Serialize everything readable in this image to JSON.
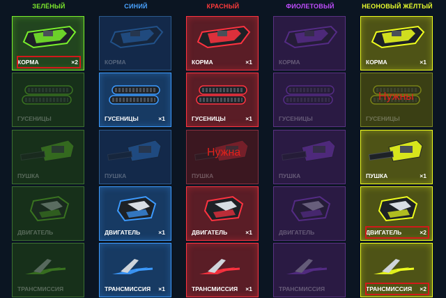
{
  "columns": [
    {
      "title": "ЗЕЛЁНЫЙ",
      "title_color": "#7eea2d",
      "bg": "#22451f",
      "bg_dim": "#17301a",
      "border": "#3c7030",
      "accent": "#7af02c",
      "items": [
        {
          "label": "КОРМА",
          "count": "×2",
          "active": true,
          "highlight": true,
          "icon": "hull-icon"
        },
        {
          "label": "ГУСЕНИЦЫ",
          "count": "",
          "active": false,
          "highlight": false,
          "icon": "tracks-icon"
        },
        {
          "label": "ПУШКА",
          "count": "",
          "active": false,
          "highlight": false,
          "icon": "turret-icon"
        },
        {
          "label": "ДВИГАТЕЛЬ",
          "count": "",
          "active": false,
          "highlight": false,
          "icon": "engine-icon"
        },
        {
          "label": "ТРАНСМИССИЯ",
          "count": "",
          "active": false,
          "highlight": false,
          "icon": "transmission-icon"
        }
      ]
    },
    {
      "title": "СИНИЙ",
      "title_color": "#4aa3ff",
      "bg": "#173a63",
      "bg_dim": "#13294a",
      "border": "#2c5b8e",
      "accent": "#3d9bff",
      "items": [
        {
          "label": "КОРМА",
          "count": "",
          "active": false,
          "highlight": false,
          "icon": "hull-icon"
        },
        {
          "label": "ГУСЕНИЦЫ",
          "count": "×1",
          "active": true,
          "highlight": false,
          "icon": "tracks-icon"
        },
        {
          "label": "ПУШКА",
          "count": "",
          "active": false,
          "highlight": false,
          "icon": "turret-icon"
        },
        {
          "label": "ДВИГАТЕЛЬ",
          "count": "×1",
          "active": true,
          "highlight": false,
          "icon": "engine-icon"
        },
        {
          "label": "ТРАНСМИССИЯ",
          "count": "×1",
          "active": true,
          "highlight": false,
          "icon": "transmission-icon"
        }
      ]
    },
    {
      "title": "КРАСНЫЙ",
      "title_color": "#ff3b3b",
      "bg": "#5a1d26",
      "bg_dim": "#3b1720",
      "border": "#8a3040",
      "accent": "#ff3340",
      "items": [
        {
          "label": "КОРМА",
          "count": "×1",
          "active": true,
          "highlight": false,
          "icon": "hull-icon"
        },
        {
          "label": "ГУСЕНИЦЫ",
          "count": "×1",
          "active": true,
          "highlight": false,
          "icon": "tracks-icon"
        },
        {
          "label": "ПУШКА",
          "count": "",
          "active": false,
          "highlight": false,
          "icon": "turret-icon"
        },
        {
          "label": "ДВИГАТЕЛЬ",
          "count": "×1",
          "active": true,
          "highlight": false,
          "icon": "engine-icon"
        },
        {
          "label": "ТРАНСМИССИЯ",
          "count": "×1",
          "active": true,
          "highlight": false,
          "icon": "transmission-icon"
        }
      ]
    },
    {
      "title": "ФИОЛЕТОВЫЙ",
      "title_color": "#c04dff",
      "bg": "#3a1d57",
      "bg_dim": "#2a1a43",
      "border": "#5a3283",
      "accent": "#a44dff",
      "items": [
        {
          "label": "КОРМА",
          "count": "",
          "active": false,
          "highlight": false,
          "icon": "hull-icon"
        },
        {
          "label": "ГУСЕНИЦЫ",
          "count": "",
          "active": false,
          "highlight": false,
          "icon": "tracks-icon"
        },
        {
          "label": "ПУШКА",
          "count": "",
          "active": false,
          "highlight": false,
          "icon": "turret-icon"
        },
        {
          "label": "ДВИГАТЕЛЬ",
          "count": "",
          "active": false,
          "highlight": false,
          "icon": "engine-icon"
        },
        {
          "label": "ТРАНСМИССИЯ",
          "count": "",
          "active": false,
          "highlight": false,
          "icon": "transmission-icon"
        }
      ]
    },
    {
      "title": "НЕОНОВЫЙ ЖЁЛТЫЙ",
      "title_color": "#eaff2d",
      "bg": "#4e5316",
      "bg_dim": "#3a3f14",
      "border": "#7e8a22",
      "accent": "#f0ff1e",
      "items": [
        {
          "label": "КОРМА",
          "count": "×1",
          "active": true,
          "highlight": false,
          "icon": "hull-icon"
        },
        {
          "label": "ГУСЕНИЦЫ",
          "count": "",
          "active": false,
          "highlight": false,
          "icon": "tracks-icon"
        },
        {
          "label": "ПУШКА",
          "count": "×1",
          "active": true,
          "highlight": false,
          "icon": "turret-icon"
        },
        {
          "label": "ДВИГАТЕЛЬ",
          "count": "×2",
          "active": true,
          "highlight": true,
          "icon": "engine-icon"
        },
        {
          "label": "ТРАНСМИССИЯ",
          "count": "×2",
          "active": true,
          "highlight": true,
          "icon": "transmission-icon"
        }
      ]
    }
  ],
  "annotations": {
    "red_needed": "Нужна",
    "yellow_needed": "Нужны"
  }
}
